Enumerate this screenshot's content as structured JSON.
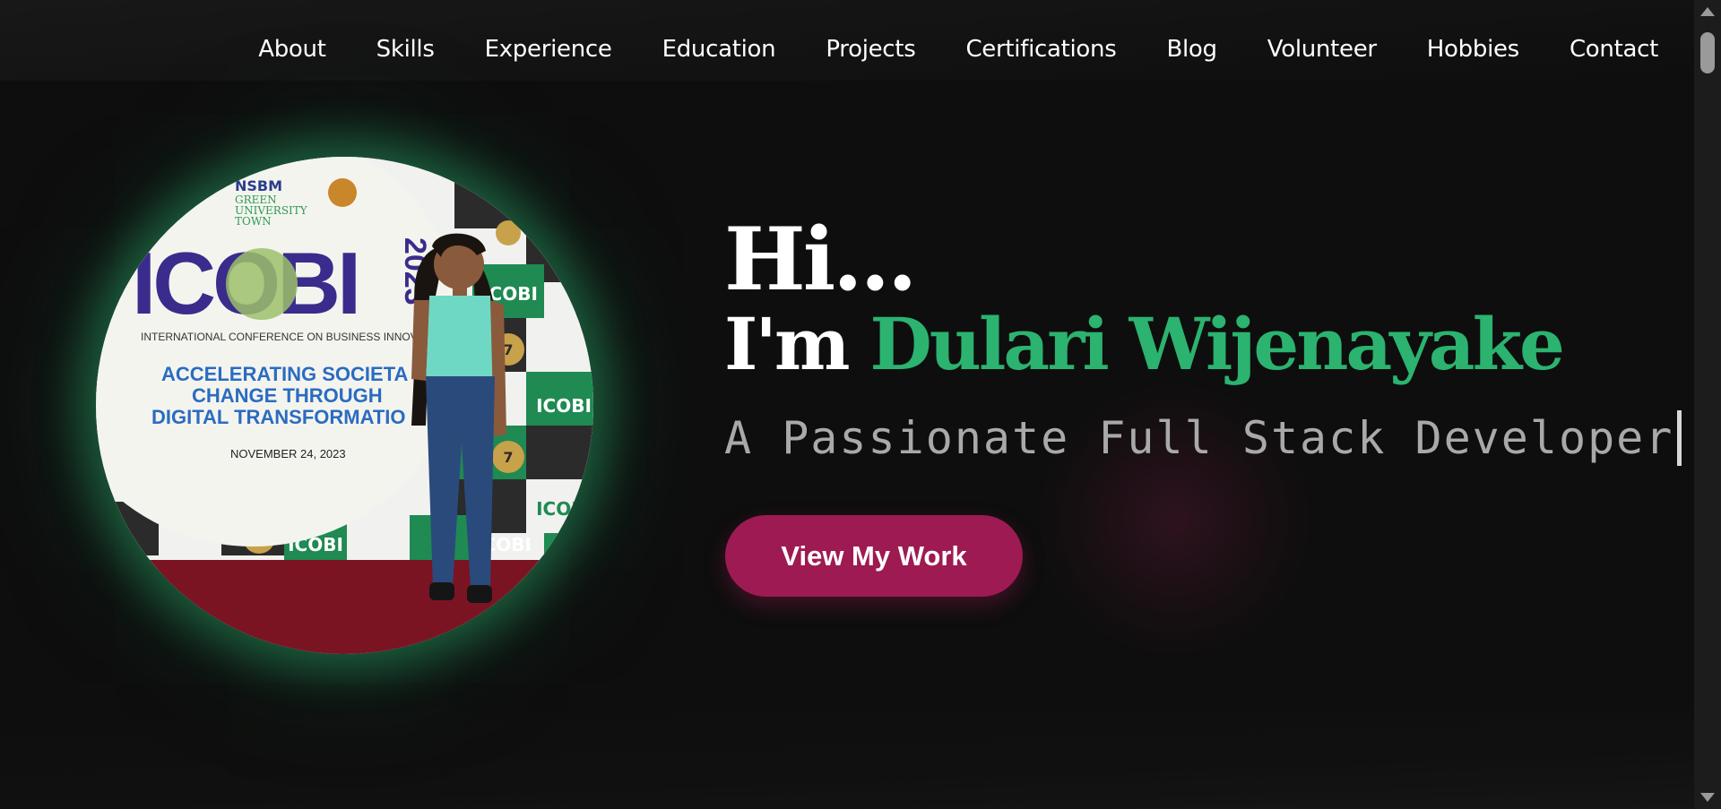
{
  "nav": {
    "items": [
      {
        "label": "About"
      },
      {
        "label": "Skills"
      },
      {
        "label": "Experience"
      },
      {
        "label": "Education"
      },
      {
        "label": "Projects"
      },
      {
        "label": "Certifications"
      },
      {
        "label": "Blog"
      },
      {
        "label": "Volunteer"
      },
      {
        "label": "Hobbies"
      },
      {
        "label": "Contact"
      }
    ]
  },
  "hero": {
    "greeting": "Hi...",
    "intro_prefix": "I'm ",
    "name": "Dulari Wijenayake",
    "tagline": "A Passionate Full Stack Developer",
    "cta_label": "View My Work"
  },
  "profile_photo": {
    "banner_top": "NSBM",
    "banner_sub1": "GREEN",
    "banner_sub2": "UNIVERSITY",
    "banner_sub3": "TOWN",
    "banner_logo_text": "ICOBI",
    "banner_year": "2023",
    "banner_conference": "INTERNATIONAL CONFERENCE ON BUSINESS INNOV",
    "banner_line1": "ACCELERATING SOCIETA",
    "banner_line2": "CHANGE THROUGH",
    "banner_line3": "DIGITAL TRANSFORMATIO",
    "banner_date": "NOVEMBER 24, 2023",
    "tile_text": "ICOBI",
    "tile_badge": "7"
  },
  "colors": {
    "accent_green": "#2bb36f",
    "accent_magenta": "#9e1a52",
    "background": "#0e0e0e",
    "tagline_gray": "#a9a9a9"
  },
  "icons": {
    "scroll_up": "scroll-up-arrow-icon",
    "scroll_down": "scroll-down-arrow-icon"
  }
}
